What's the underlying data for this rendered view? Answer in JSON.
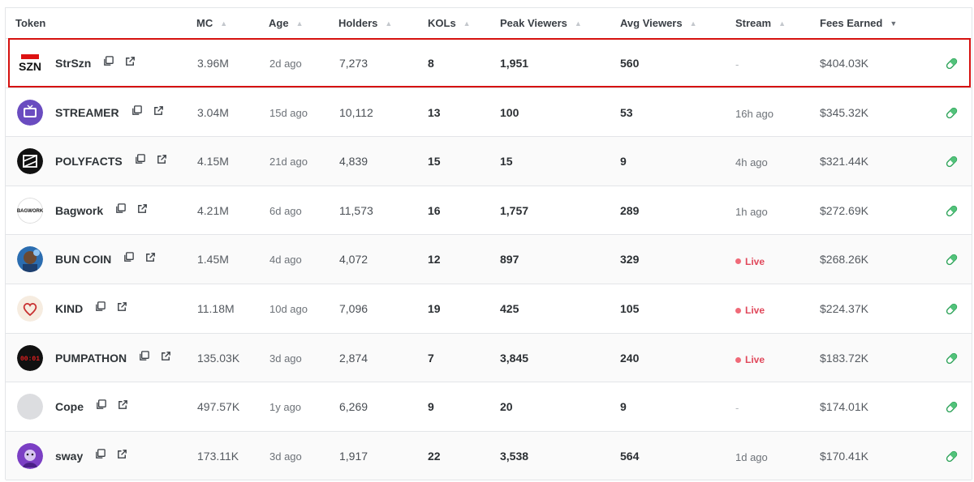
{
  "columns": {
    "token": "Token",
    "mc": "MC",
    "age": "Age",
    "holders": "Holders",
    "kols": "KOLs",
    "peak": "Peak Viewers",
    "avg": "Avg Viewers",
    "stream": "Stream",
    "fees": "Fees Earned"
  },
  "sort_icons": {
    "asc": "▲",
    "desc": "▼"
  },
  "rows": [
    {
      "name": "StrSzn",
      "avatar_icon": "strszn-logo",
      "mc": "3.96M",
      "age": "2d ago",
      "holders": "7,273",
      "kols": "8",
      "peak": "1,951",
      "avg": "560",
      "stream_type": "none",
      "stream": "-",
      "fees": "$404.03K",
      "selected": true
    },
    {
      "name": "STREAMER",
      "avatar_icon": "tv-logo",
      "mc": "3.04M",
      "age": "15d ago",
      "holders": "10,112",
      "kols": "13",
      "peak": "100",
      "avg": "53",
      "stream_type": "ago",
      "stream": "16h ago",
      "fees": "$345.32K"
    },
    {
      "name": "POLYFACTS",
      "avatar_icon": "polyfacts-logo",
      "mc": "4.15M",
      "age": "21d ago",
      "holders": "4,839",
      "kols": "15",
      "peak": "15",
      "avg": "9",
      "stream_type": "ago",
      "stream": "4h ago",
      "fees": "$321.44K"
    },
    {
      "name": "Bagwork",
      "avatar_icon": "bagwork-logo",
      "mc": "4.21M",
      "age": "6d ago",
      "holders": "11,573",
      "kols": "16",
      "peak": "1,757",
      "avg": "289",
      "stream_type": "ago",
      "stream": "1h ago",
      "fees": "$272.69K"
    },
    {
      "name": "BUN COIN",
      "avatar_icon": "bun-coin-avatar",
      "mc": "1.45M",
      "age": "4d ago",
      "holders": "4,072",
      "kols": "12",
      "peak": "897",
      "avg": "329",
      "stream_type": "live",
      "stream": "Live",
      "fees": "$268.26K"
    },
    {
      "name": "KIND",
      "avatar_icon": "heart-logo",
      "mc": "11.18M",
      "age": "10d ago",
      "holders": "7,096",
      "kols": "19",
      "peak": "425",
      "avg": "105",
      "stream_type": "live",
      "stream": "Live",
      "fees": "$224.37K"
    },
    {
      "name": "PUMPATHON",
      "avatar_icon": "pumpathon-logo",
      "mc": "135.03K",
      "age": "3d ago",
      "holders": "2,874",
      "kols": "7",
      "peak": "3,845",
      "avg": "240",
      "stream_type": "live",
      "stream": "Live",
      "fees": "$183.72K"
    },
    {
      "name": "Cope",
      "avatar_icon": "blank-avatar",
      "mc": "497.57K",
      "age": "1y ago",
      "holders": "6,269",
      "kols": "9",
      "peak": "20",
      "avg": "9",
      "stream_type": "none",
      "stream": "-",
      "fees": "$174.01K"
    },
    {
      "name": "sway",
      "avatar_icon": "sway-avatar",
      "mc": "173.11K",
      "age": "3d ago",
      "holders": "1,917",
      "kols": "22",
      "peak": "3,538",
      "avg": "564",
      "stream_type": "ago",
      "stream": "1d ago",
      "fees": "$170.41K"
    }
  ],
  "colors": {
    "highlight": "#d6110f",
    "live": "#e0475a",
    "pill": "#2fa35a"
  }
}
